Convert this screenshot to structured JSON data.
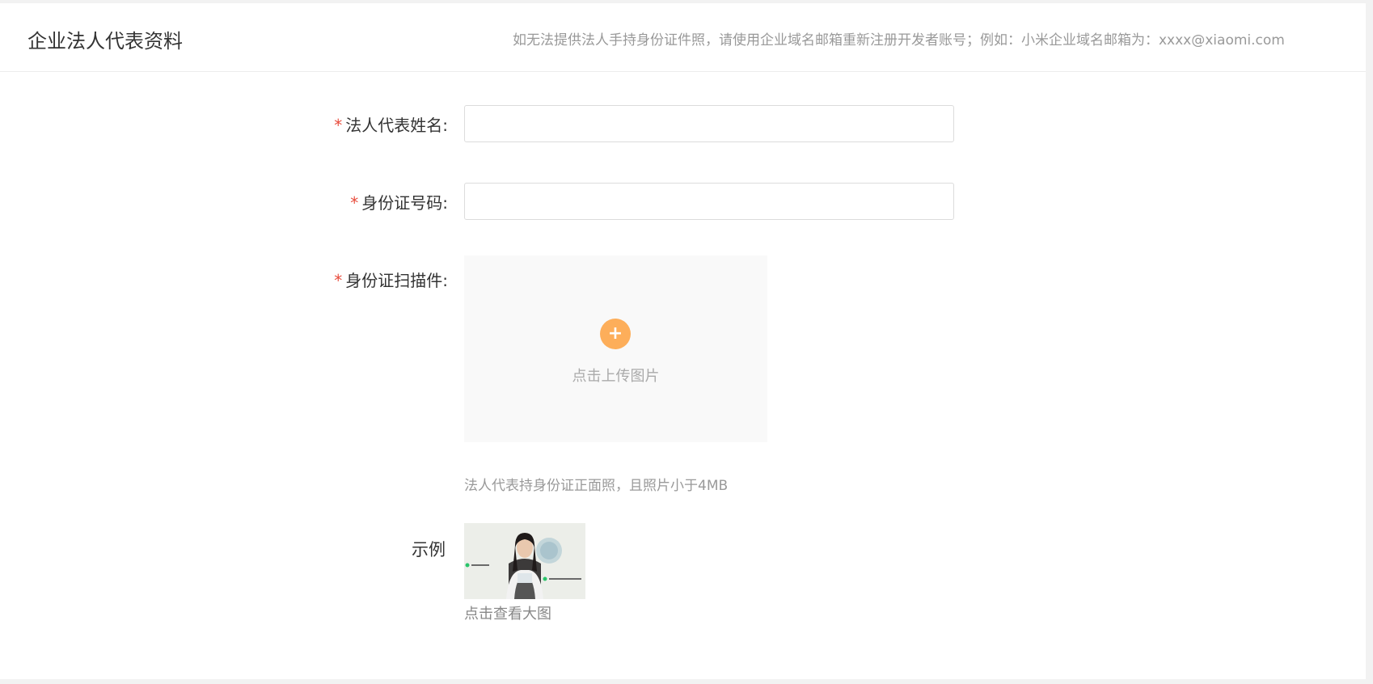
{
  "header": {
    "title": "企业法人代表资料",
    "note": "如无法提供法人手持身份证件照，请使用企业域名邮箱重新注册开发者账号；例如：小米企业域名邮箱为：xxxx@xiaomi.com"
  },
  "form": {
    "required_mark": "*",
    "name": {
      "label": "法人代表姓名:",
      "value": "",
      "placeholder": ""
    },
    "id_number": {
      "label": "身份证号码:",
      "value": "",
      "placeholder": ""
    },
    "id_scan": {
      "label": "身份证扫描件:",
      "upload_icon": "plus-icon",
      "upload_symbol": "+",
      "upload_text": "点击上传图片",
      "hint": "法人代表持身份证正面照，且照片小于4MB"
    },
    "example": {
      "label": "示例",
      "view_link": "点击查看大图"
    }
  },
  "colors": {
    "required": "#e84c3d",
    "upload_accent": "#fdae5a",
    "example_dot": "#29c46a"
  }
}
